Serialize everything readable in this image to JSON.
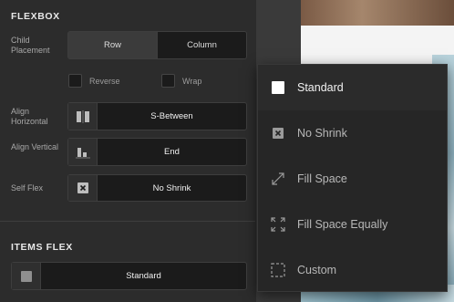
{
  "flexbox": {
    "title": "FLEXBOX",
    "child_placement": {
      "label": "Child Placement",
      "options": [
        "Row",
        "Column"
      ],
      "selected": "Row"
    },
    "reverse": {
      "label": "Reverse",
      "checked": false
    },
    "wrap": {
      "label": "Wrap",
      "checked": false
    },
    "align_horizontal": {
      "label": "Align Horizontal",
      "icon": "space-between-icon",
      "value": "S-Between"
    },
    "align_vertical": {
      "label": "Align Vertical",
      "icon": "align-end-icon",
      "value": "End"
    },
    "self_flex": {
      "label": "Self Flex",
      "icon": "no-shrink-icon",
      "value": "No Shrink"
    }
  },
  "items_flex": {
    "title": "ITEMS FLEX",
    "icon": "standard-square-icon",
    "value": "Standard"
  },
  "flex_menu": {
    "selected": "Standard",
    "items": [
      {
        "label": "Standard",
        "icon": "white-square-icon"
      },
      {
        "label": "No Shrink",
        "icon": "no-shrink-icon"
      },
      {
        "label": "Fill Space",
        "icon": "expand-diagonal-icon"
      },
      {
        "label": "Fill Space Equally",
        "icon": "expand-corners-icon"
      },
      {
        "label": "Custom",
        "icon": "dashed-square-icon"
      }
    ]
  },
  "colors": {
    "panel_bg": "#2c2c2c",
    "control_bg": "#1b1b1b",
    "menu_bg": "#262626",
    "text_primary": "#f0f0f0",
    "text_muted": "#a8a8a8"
  }
}
